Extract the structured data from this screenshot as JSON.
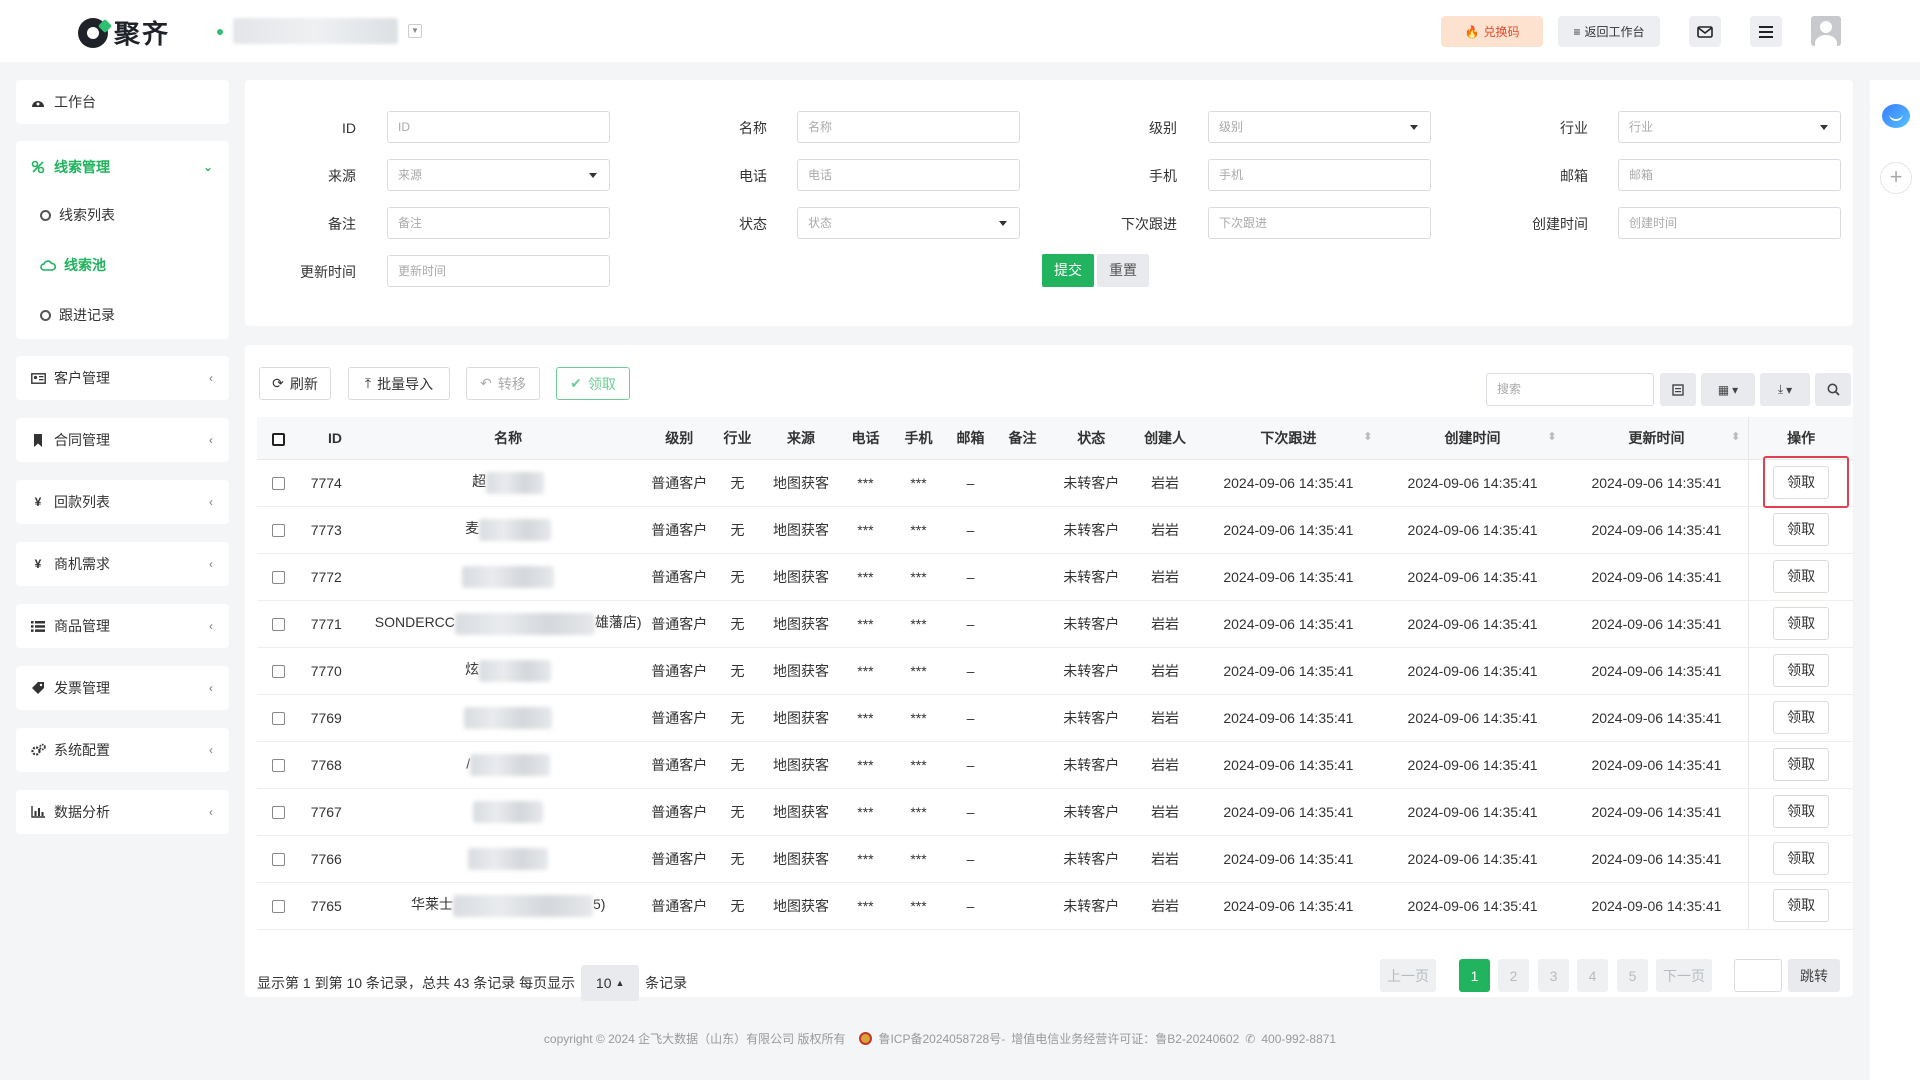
{
  "header": {
    "brand": "聚齐",
    "redeem_label": "兑换码",
    "back_label": "返回工作台"
  },
  "sidebar": {
    "dashboard": "工作台",
    "lead_mgmt": "线索管理",
    "lead_list": "线索列表",
    "lead_pool": "线索池",
    "followup": "跟进记录",
    "groups": [
      {
        "label": "客户管理",
        "icon": "id-card-icon"
      },
      {
        "label": "合同管理",
        "icon": "bookmark-icon"
      },
      {
        "label": "回款列表",
        "icon": "yen-icon"
      },
      {
        "label": "商机需求",
        "icon": "yen-icon"
      },
      {
        "label": "商品管理",
        "icon": "list-icon"
      },
      {
        "label": "发票管理",
        "icon": "tag-icon"
      },
      {
        "label": "系统配置",
        "icon": "gears-icon"
      },
      {
        "label": "数据分析",
        "icon": "bar-chart-icon"
      }
    ]
  },
  "filters": {
    "id_label": "ID",
    "id_ph": "ID",
    "name_label": "名称",
    "name_ph": "名称",
    "level_label": "级别",
    "level_ph": "级别",
    "industry_label": "行业",
    "industry_ph": "行业",
    "source_label": "来源",
    "source_ph": "来源",
    "phone_label": "电话",
    "phone_ph": "电话",
    "mobile_label": "手机",
    "mobile_ph": "手机",
    "email_label": "邮箱",
    "email_ph": "邮箱",
    "remark_label": "备注",
    "remark_ph": "备注",
    "status_label": "状态",
    "status_ph": "状态",
    "next_label": "下次跟进",
    "next_ph": "下次跟进",
    "created_label": "创建时间",
    "created_ph": "创建时间",
    "updated_label": "更新时间",
    "updated_ph": "更新时间",
    "submit": "提交",
    "reset": "重置"
  },
  "toolbar": {
    "refresh": "刷新",
    "import": "批量导入",
    "transfer": "转移",
    "claim": "领取",
    "search_ph": "搜索"
  },
  "table": {
    "headers": [
      "ID",
      "名称",
      "级别",
      "行业",
      "来源",
      "电话",
      "手机",
      "邮箱",
      "备注",
      "状态",
      "创建人",
      "下次跟进",
      "创建时间",
      "更新时间",
      "操作"
    ],
    "action_label": "领取",
    "rows": [
      {
        "id": "7774",
        "name_pre": "超",
        "name_post": "",
        "level": "普通客户",
        "industry": "无",
        "source": "地图获客",
        "phone": "***",
        "mobile": "***",
        "email": "–",
        "status": "未转客户",
        "creator": "岩岩",
        "next": "2024-09-06 14:35:41",
        "created": "2024-09-06 14:35:41",
        "updated": "2024-09-06 14:35:41"
      },
      {
        "id": "7773",
        "name_pre": "麦",
        "name_post": "",
        "level": "普通客户",
        "industry": "无",
        "source": "地图获客",
        "phone": "***",
        "mobile": "***",
        "email": "–",
        "status": "未转客户",
        "creator": "岩岩",
        "next": "2024-09-06 14:35:41",
        "created": "2024-09-06 14:35:41",
        "updated": "2024-09-06 14:35:41"
      },
      {
        "id": "7772",
        "name_pre": "",
        "name_post": "",
        "level": "普通客户",
        "industry": "无",
        "source": "地图获客",
        "phone": "***",
        "mobile": "***",
        "email": "–",
        "status": "未转客户",
        "creator": "岩岩",
        "next": "2024-09-06 14:35:41",
        "created": "2024-09-06 14:35:41",
        "updated": "2024-09-06 14:35:41"
      },
      {
        "id": "7771",
        "name_pre": "SONDERCC",
        "name_post": "雄藩店)",
        "level": "普通客户",
        "industry": "无",
        "source": "地图获客",
        "phone": "***",
        "mobile": "***",
        "email": "–",
        "status": "未转客户",
        "creator": "岩岩",
        "next": "2024-09-06 14:35:41",
        "created": "2024-09-06 14:35:41",
        "updated": "2024-09-06 14:35:41"
      },
      {
        "id": "7770",
        "name_pre": "炫",
        "name_post": "",
        "level": "普通客户",
        "industry": "无",
        "source": "地图获客",
        "phone": "***",
        "mobile": "***",
        "email": "–",
        "status": "未转客户",
        "creator": "岩岩",
        "next": "2024-09-06 14:35:41",
        "created": "2024-09-06 14:35:41",
        "updated": "2024-09-06 14:35:41"
      },
      {
        "id": "7769",
        "name_pre": "",
        "name_post": "",
        "level": "普通客户",
        "industry": "无",
        "source": "地图获客",
        "phone": "***",
        "mobile": "***",
        "email": "–",
        "status": "未转客户",
        "creator": "岩岩",
        "next": "2024-09-06 14:35:41",
        "created": "2024-09-06 14:35:41",
        "updated": "2024-09-06 14:35:41"
      },
      {
        "id": "7768",
        "name_pre": "/",
        "name_post": "",
        "level": "普通客户",
        "industry": "无",
        "source": "地图获客",
        "phone": "***",
        "mobile": "***",
        "email": "–",
        "status": "未转客户",
        "creator": "岩岩",
        "next": "2024-09-06 14:35:41",
        "created": "2024-09-06 14:35:41",
        "updated": "2024-09-06 14:35:41"
      },
      {
        "id": "7767",
        "name_pre": "",
        "name_post": "",
        "level": "普通客户",
        "industry": "无",
        "source": "地图获客",
        "phone": "***",
        "mobile": "***",
        "email": "–",
        "status": "未转客户",
        "creator": "岩岩",
        "next": "2024-09-06 14:35:41",
        "created": "2024-09-06 14:35:41",
        "updated": "2024-09-06 14:35:41"
      },
      {
        "id": "7766",
        "name_pre": "",
        "name_post": "",
        "level": "普通客户",
        "industry": "无",
        "source": "地图获客",
        "phone": "***",
        "mobile": "***",
        "email": "–",
        "status": "未转客户",
        "creator": "岩岩",
        "next": "2024-09-06 14:35:41",
        "created": "2024-09-06 14:35:41",
        "updated": "2024-09-06 14:35:41"
      },
      {
        "id": "7765",
        "name_pre": "华莱士",
        "name_post": "5)",
        "level": "普通客户",
        "industry": "无",
        "source": "地图获客",
        "phone": "***",
        "mobile": "***",
        "email": "–",
        "status": "未转客户",
        "creator": "岩岩",
        "next": "2024-09-06 14:35:41",
        "created": "2024-09-06 14:35:41",
        "updated": "2024-09-06 14:35:41"
      }
    ]
  },
  "pagination": {
    "info_pre": "显示第 1 到第 10 条记录，总共 43 条记录 每页显示",
    "page_size": "10",
    "info_post": "条记录",
    "prev": "上一页",
    "pages": [
      "1",
      "2",
      "3",
      "4",
      "5"
    ],
    "next": "下一页",
    "jump": "跳转"
  },
  "footer": {
    "copyright": "copyright © 2024 企飞大数据（山东）有限公司 版权所有",
    "icp": "鲁ICP备2024058728号-",
    "license": "增值电信业务经营许可证：鲁B2-20240602",
    "phone": "400-992-8871"
  },
  "colors": {
    "accent": "#21b35e",
    "highlight": "#e0404f"
  }
}
